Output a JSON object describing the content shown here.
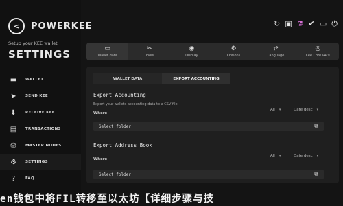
{
  "brand": {
    "mark": "<",
    "name": "POWERKEE",
    "setup_line": "Setup your KEE wallet",
    "section_title": "SETTINGS"
  },
  "nav": {
    "items": [
      {
        "label": "WALLET",
        "icon": "wallet-icon",
        "glyph": "▬"
      },
      {
        "label": "SEND KEE",
        "icon": "send-icon",
        "glyph": "➤"
      },
      {
        "label": "RECEIVE KEE",
        "icon": "receive-icon",
        "glyph": "⬇"
      },
      {
        "label": "TRANSACTIONS",
        "icon": "transactions-icon",
        "glyph": "▤"
      },
      {
        "label": "MASTER NODES",
        "icon": "masternodes-icon",
        "glyph": "⛁"
      },
      {
        "label": "SETTINGS",
        "icon": "gear-icon",
        "glyph": "⚙",
        "active": true
      },
      {
        "label": "FAQ",
        "icon": "help-icon",
        "glyph": "?"
      }
    ]
  },
  "topbar": {
    "icons": [
      "↻",
      "▣",
      "⚗",
      "✔",
      "▭",
      "⏻"
    ]
  },
  "tabs": [
    {
      "label": "Wallet data",
      "glyph": "▭",
      "active": true
    },
    {
      "label": "Tools",
      "glyph": "✂"
    },
    {
      "label": "Display",
      "glyph": "◉"
    },
    {
      "label": "Options",
      "glyph": "⚙"
    },
    {
      "label": "Language",
      "glyph": "⇄"
    },
    {
      "label": "Kee Core v4.9",
      "glyph": "◎"
    }
  ],
  "subtabs": {
    "wallet_data": "WALLET DATA",
    "export_accounting": "EXPORT ACCOUNTING"
  },
  "export_accounting": {
    "title": "Export Accounting",
    "desc": "Export your wallets accounting data to a CSV file.",
    "where": "Where",
    "filter_value": "All",
    "sort_value": "Date desc",
    "folder_placeholder": "Select folder"
  },
  "export_address_book": {
    "title": "Export Address Book",
    "where": "Where",
    "filter_value": "All",
    "sort_value": "Date desc",
    "folder_placeholder": "Select folder"
  },
  "overlay_text": "en钱包中将FIL转移至以太坊【详细步骤与技",
  "colors": {
    "background": "#141414",
    "sidebar": "#111111",
    "panel": "#1f1f1f",
    "accent": "#d46fd4"
  }
}
